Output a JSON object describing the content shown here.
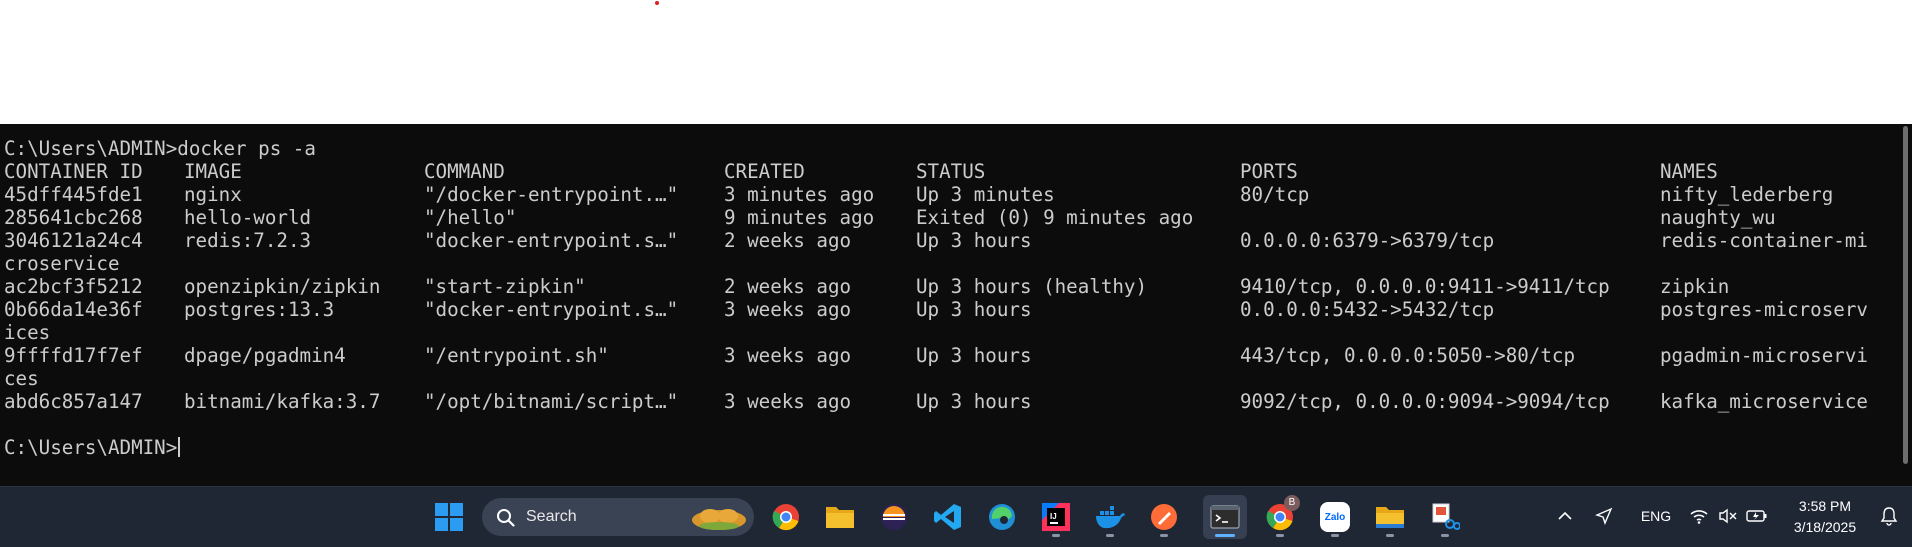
{
  "terminal": {
    "command_line": "C:\\Users\\ADMIN>docker ps -a",
    "headers": [
      "CONTAINER ID",
      "IMAGE",
      "COMMAND",
      "CREATED",
      "STATUS",
      "PORTS",
      "NAMES"
    ],
    "rows": [
      {
        "id": "45dff445fde1",
        "image": "nginx",
        "command": "\"/docker-entrypoint.…\"",
        "created": "3 minutes ago",
        "status": "Up 3 minutes",
        "ports": "80/tcp",
        "name": "nifty_lederberg",
        "name_cont": ""
      },
      {
        "id": "285641cbc268",
        "image": "hello-world",
        "command": "\"/hello\"",
        "created": "9 minutes ago",
        "status": "Exited (0) 9 minutes ago",
        "ports": "",
        "name": "naughty_wu",
        "name_cont": ""
      },
      {
        "id": "3046121a24c4",
        "image": "redis:7.2.3",
        "command": "\"docker-entrypoint.s…\"",
        "created": "2 weeks ago",
        "status": "Up 3 hours",
        "ports": "0.0.0.0:6379->6379/tcp",
        "name": "redis-container-mi",
        "name_cont": "croservice"
      },
      {
        "id": "ac2bcf3f5212",
        "image": "openzipkin/zipkin",
        "command": "\"start-zipkin\"",
        "created": "2 weeks ago",
        "status": "Up 3 hours (healthy)",
        "ports": "9410/tcp, 0.0.0.0:9411->9411/tcp",
        "name": "zipkin",
        "name_cont": ""
      },
      {
        "id": "0b66da14e36f",
        "image": "postgres:13.3",
        "command": "\"docker-entrypoint.s…\"",
        "created": "3 weeks ago",
        "status": "Up 3 hours",
        "ports": "0.0.0.0:5432->5432/tcp",
        "name": "postgres-microserv",
        "name_cont": "ices"
      },
      {
        "id": "9ffffd17f7ef",
        "image": "dpage/pgadmin4",
        "command": "\"/entrypoint.sh\"",
        "created": "3 weeks ago",
        "status": "Up 3 hours",
        "ports": "443/tcp, 0.0.0.0:5050->80/tcp",
        "name": "pgadmin-microservi",
        "name_cont": "ces"
      },
      {
        "id": "abd6c857a147",
        "image": "bitnami/kafka:3.7",
        "command": "\"/opt/bitnami/script…\"",
        "created": "3 weeks ago",
        "status": "Up 3 hours",
        "ports": "9092/tcp, 0.0.0.0:9094->9094/tcp",
        "name": "kafka_microservice",
        "name_cont": ""
      }
    ],
    "prompt": "C:\\Users\\ADMIN>"
  },
  "taskbar": {
    "search_placeholder": "Search",
    "apps": [
      {
        "name": "windows-start-icon",
        "color": "#2b9cf2"
      },
      {
        "name": "chrome-icon",
        "color": "#ea4335"
      },
      {
        "name": "file-explorer-icon",
        "color": "#f5c02e"
      },
      {
        "name": "eclipse-icon",
        "color": "#2c2255"
      },
      {
        "name": "vscode-icon",
        "color": "#23a9f2"
      },
      {
        "name": "edge-icon",
        "color": "#1f8fd6"
      },
      {
        "name": "intellij-icon",
        "color": "#fe315d"
      },
      {
        "name": "docker-icon",
        "color": "#1d91e6"
      },
      {
        "name": "postman-icon",
        "color": "#ff6c37"
      },
      {
        "name": "terminal-icon",
        "color": "#2d2d2d"
      },
      {
        "name": "chrome-profile-icon",
        "color": "#ea4335"
      },
      {
        "name": "zalo-icon",
        "color": "#0068ff"
      },
      {
        "name": "file-explorer-2-icon",
        "color": "#f5c02e"
      },
      {
        "name": "snipping-tool-icon",
        "color": "#e2543c"
      }
    ],
    "chrome_badge": "B",
    "zalo_label": "Zalo",
    "tray": {
      "language": "ENG",
      "time": "3:58 PM",
      "date": "3/18/2025"
    }
  }
}
